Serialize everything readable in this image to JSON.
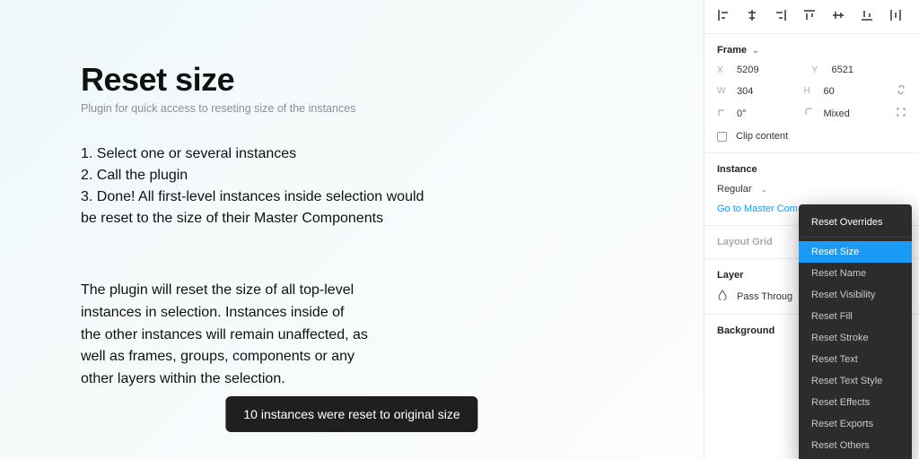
{
  "canvas": {
    "title": "Reset size",
    "subtitle": "Plugin for quick access to reseting size of the instances",
    "steps": [
      "1. Select one or several instances",
      "2. Call the plugin",
      "3. Done! All first-level instances inside selection would be reset to the size of their Master Components"
    ],
    "description": "The plugin will reset the size of all top-level instances in selection. Instances inside of the other instances will remain unaffected, as well as frames, groups, components or any other layers within the selection.",
    "toast": "10 instances were reset to original size"
  },
  "panel": {
    "frame": {
      "label": "Frame",
      "x": "5209",
      "y": "6521",
      "w": "304",
      "h": "60",
      "rotation": "0°",
      "corner": "Mixed",
      "clip_label": "Clip content"
    },
    "instance": {
      "label": "Instance",
      "variant": "Regular",
      "go_master": "Go to Master Com"
    },
    "layout_grid": "Layout Grid",
    "layer": {
      "label": "Layer",
      "blend": "Pass Throug"
    },
    "background": "Background"
  },
  "menu": {
    "header": "Reset Overrides",
    "items": [
      "Reset Size",
      "Reset Name",
      "Reset Visibility",
      "Reset Fill",
      "Reset Stroke",
      "Reset Text",
      "Reset Text Style",
      "Reset Effects",
      "Reset Exports",
      "Reset Others"
    ],
    "active_index": 0
  }
}
